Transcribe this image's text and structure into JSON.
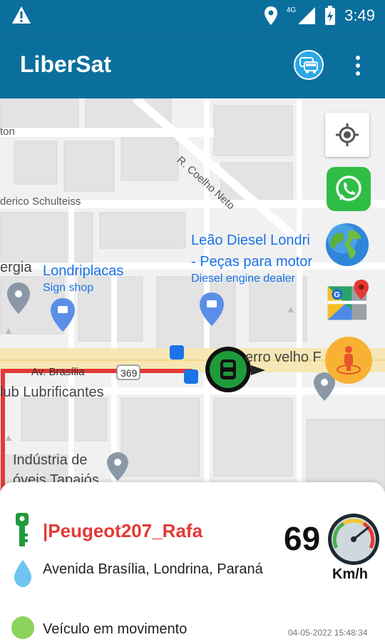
{
  "status_bar": {
    "network": "4G",
    "time": "3:49"
  },
  "app_bar": {
    "title": "LiberSat",
    "icons": [
      "vehicles-icon",
      "more-vert-icon"
    ]
  },
  "map": {
    "street_labels": [
      "R. Coelho Neto",
      "derico Schulteiss",
      "ton",
      "Av. Brasília",
      "369"
    ],
    "poi_labels": {
      "leao_line1": "Leão Diesel Londri",
      "leao_line2": "- Peças para motor",
      "leao_category": "Diesel engine dealer",
      "londriplacas": "Londriplacas",
      "londriplacas_category": "Sign shop",
      "ergia": "ergia",
      "lubrificantes": "lub Lubrificantes",
      "industria_line1": "Indústria de",
      "industria_line2": "óveis Tapajós",
      "ferro_velho": "erro velho F"
    },
    "side_buttons": [
      "my-location-icon",
      "whatsapp-icon",
      "globe-icon",
      "google-maps-icon",
      "street-view-icon"
    ]
  },
  "vehicle": {
    "name": "|Peugeot207_Rafa",
    "address": "Avenida Brasília, Londrina, Paraná",
    "status": "Veículo em movimento",
    "status_color": "#8bd35a",
    "speed": "69",
    "speed_unit": "Km/h",
    "timestamp": "04-05-2022 15:48:34"
  },
  "colors": {
    "primary": "#0a6f9d",
    "route": "#e53935",
    "accent_blue": "#2aa8e6"
  }
}
